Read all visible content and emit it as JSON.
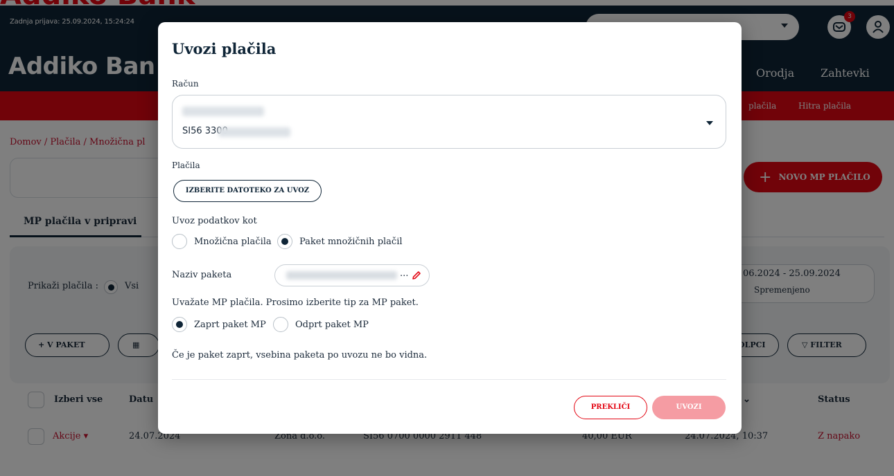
{
  "brand": {
    "name": "Addiko Bank",
    "accent_color": "#e30613",
    "navy_color": "#0f2537"
  },
  "header": {
    "last_login": "Zadnja prijava: 25.09.2024, 15:24:24",
    "logo": "Addiko Ban",
    "notification_count": "3",
    "nav": {
      "orodja": "Orodja",
      "zahtevki": "Zahtevki"
    },
    "icons": {
      "mail": "mail-icon",
      "user": "user-icon"
    }
  },
  "subnav": {
    "placila": "plačila",
    "hitra_placila": "Hitra plačila"
  },
  "breadcrumb": "Domov / Plačila / Množična pl",
  "new_payment_button": "NOVO MP PLAČILO",
  "tabs": {
    "pending": "MP plačila v pripravi"
  },
  "filters": {
    "show_label": "Prikaži plačila :",
    "all_label": "Vsi",
    "date_range": "06.2024 - 25.09.2024",
    "date_range_sub": "Spremenjeno",
    "in_package_button": "V PAKET",
    "columns_button": "OLPCI",
    "filter_button": "FILTER"
  },
  "table": {
    "headers": {
      "select_all": "Izberi vse",
      "date": "Datu",
      "status": "Status"
    },
    "rows": [
      {
        "actions": "Akcije",
        "date": "24.07.2024",
        "name": "Zona d.o.o.",
        "iban": "SI56 0700 0000 2911 448",
        "amount": "40,00 EUR",
        "updated": "24.07.2024, 10:37",
        "status": "Z napako"
      }
    ]
  },
  "modal": {
    "title": "Uvozi plačila",
    "account_label": "Račun",
    "account_iban_prefix": "SI56 3300",
    "payments_label": "Plačila",
    "choose_file_button": "IZBERITE DATOTEKO ZA UVOZ",
    "import_as_label": "Uvoz podatkov kot",
    "import_options": [
      "Množična plačila",
      "Paket množičnih plačil"
    ],
    "import_selected": "Paket množičnih plačil",
    "package_name_label": "Naziv paketa",
    "package_name_ellipsis": "...",
    "choose_type_text": "Uvažate MP plačila. Prosimo izberite tip za MP paket.",
    "package_types": [
      "Zaprt paket MP",
      "Odprt paket MP"
    ],
    "package_type_selected": "Zaprt paket MP",
    "closed_note": "Če je paket zaprt, vsebina paketa po uvozu ne bo vidna.",
    "cancel_button": "PREKLIČI",
    "import_button": "UVOZI"
  }
}
